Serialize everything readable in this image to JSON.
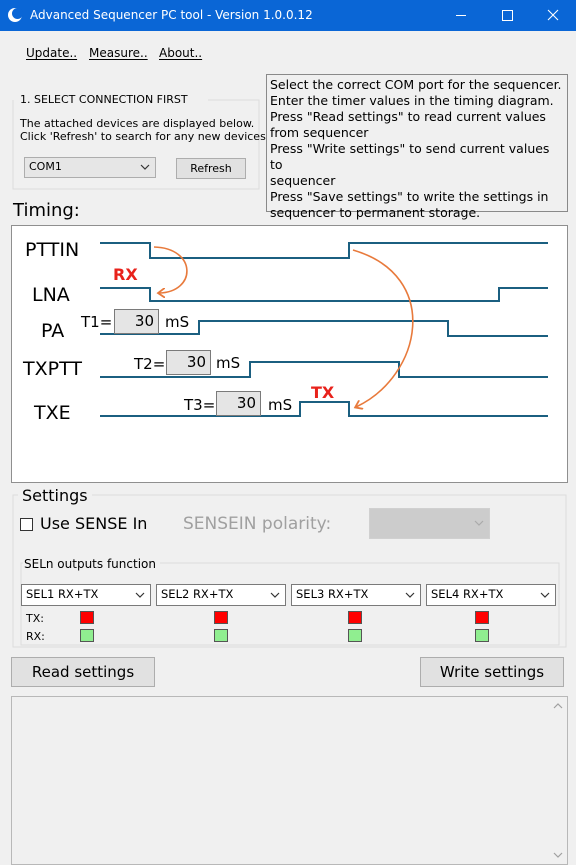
{
  "window": {
    "title": "Advanced Sequencer PC tool - Version 1.0.0.12",
    "minimize_glyph": "—",
    "maximize_glyph": "☐",
    "close_glyph": "✕",
    "app_icon": "moon-icon"
  },
  "menu": [
    "Update..",
    "Measure..",
    "About.."
  ],
  "connection": {
    "group_title": "1. SELECT CONNECTION FIRST",
    "help_line1": "The attached devices are displayed below.",
    "help_line2": "Click 'Refresh' to search for any new devices.",
    "port_value": "COM1",
    "refresh_label": "Refresh"
  },
  "instructions": [
    "Select the correct COM port for the sequencer.",
    "Enter the timer values in the timing diagram.",
    "Press \"Read settings\" to read current values",
    "from sequencer",
    "Press \"Write settings\" to send current values to",
    "sequencer",
    "Press \"Save settings\" to write the settings in",
    "sequencer to permanent storage."
  ],
  "timing": {
    "section_label": "Timing:",
    "signals": [
      "PTTIN",
      "LNA",
      "PA",
      "TXPTT",
      "TXE"
    ],
    "timers": [
      {
        "label": "T1=",
        "value": "30",
        "unit": "mS"
      },
      {
        "label": "T2=",
        "value": "30",
        "unit": "mS"
      },
      {
        "label": "T3=",
        "value": "30",
        "unit": "mS"
      }
    ],
    "rx_label": "RX",
    "tx_label": "TX",
    "colors": {
      "trace": "#1b5f80",
      "arrow": "#e87a3c",
      "marker": "#e8221b"
    }
  },
  "settings": {
    "section_label": "Settings",
    "use_sense_label": "Use SENSE In",
    "use_sense_checked": false,
    "sensein_polarity_label": "SENSEIN polarity:",
    "sensein_polarity_value": "",
    "sel_group_label": "SELn outputs function",
    "sel_outputs": [
      "SEL1 RX+TX",
      "SEL2 RX+TX",
      "SEL3 RX+TX",
      "SEL4 RX+TX"
    ],
    "tx_row_label": "TX:",
    "rx_row_label": "RX:",
    "colors": {
      "tx": "#ff0000",
      "rx": "#90ee90"
    }
  },
  "buttons": {
    "read": "Read settings",
    "write": "Write settings"
  },
  "log": {
    "text": "",
    "scroll_up_glyph": "︿",
    "scroll_down_glyph": "﹀"
  }
}
